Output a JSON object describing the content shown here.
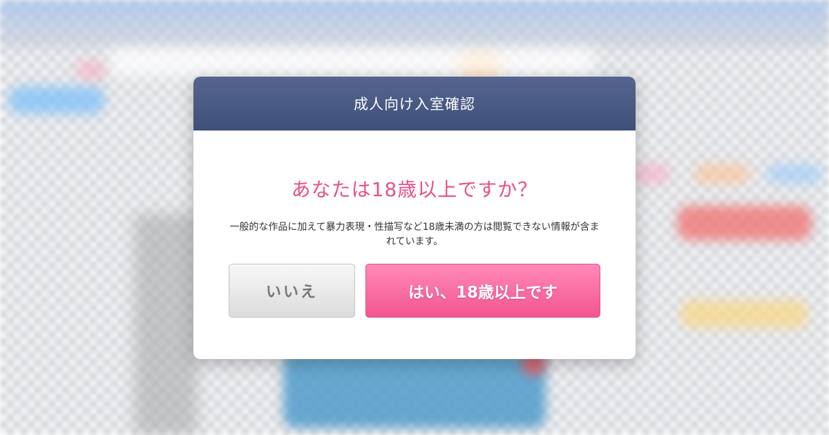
{
  "modal": {
    "title": "成人向け入室確認",
    "question": "あなたは18歳以上ですか？",
    "description": "一般的な作品に加えて暴力表現・性描写など18歳未満の方は閲覧できない情報が含まれています。",
    "buttons": {
      "no_label": "いいえ",
      "yes_label": "はい、18歳以上です"
    }
  },
  "colors": {
    "header": "#46577f",
    "accent_pink": "#f3558f",
    "question_text": "#e8508a"
  }
}
